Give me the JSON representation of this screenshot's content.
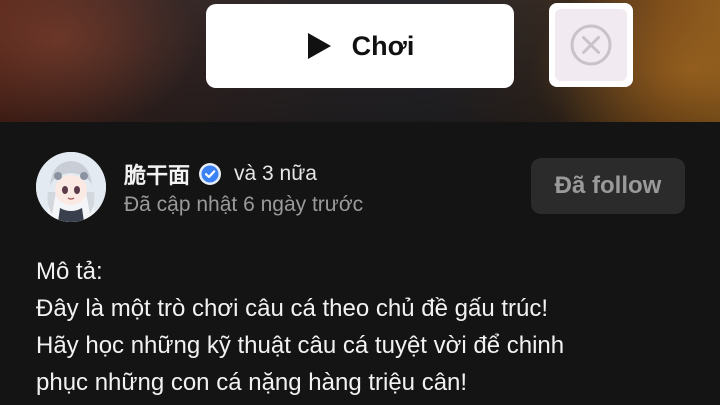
{
  "game": {
    "play_label": "Chơi"
  },
  "author": {
    "name": "脆干面",
    "extra": "và 3 nữa",
    "updated": "Đã cập nhật 6 ngày trước",
    "follow_label": "Đã follow"
  },
  "description": {
    "heading": "Mô tả:",
    "lines": [
      "Đây là một trò chơi câu cá theo chủ đề gấu trúc!",
      "Hãy học những kỹ thuật câu cá tuyệt vời để chinh",
      "phục những con cá nặng hàng triệu cân!"
    ]
  },
  "colors": {
    "background": "#141414",
    "verified_badge": "#3b82f6",
    "follow_button_bg": "#2b2b2b"
  },
  "icons": {
    "play": "play-icon",
    "close": "close-circle-icon",
    "verified": "verified-badge-icon"
  }
}
